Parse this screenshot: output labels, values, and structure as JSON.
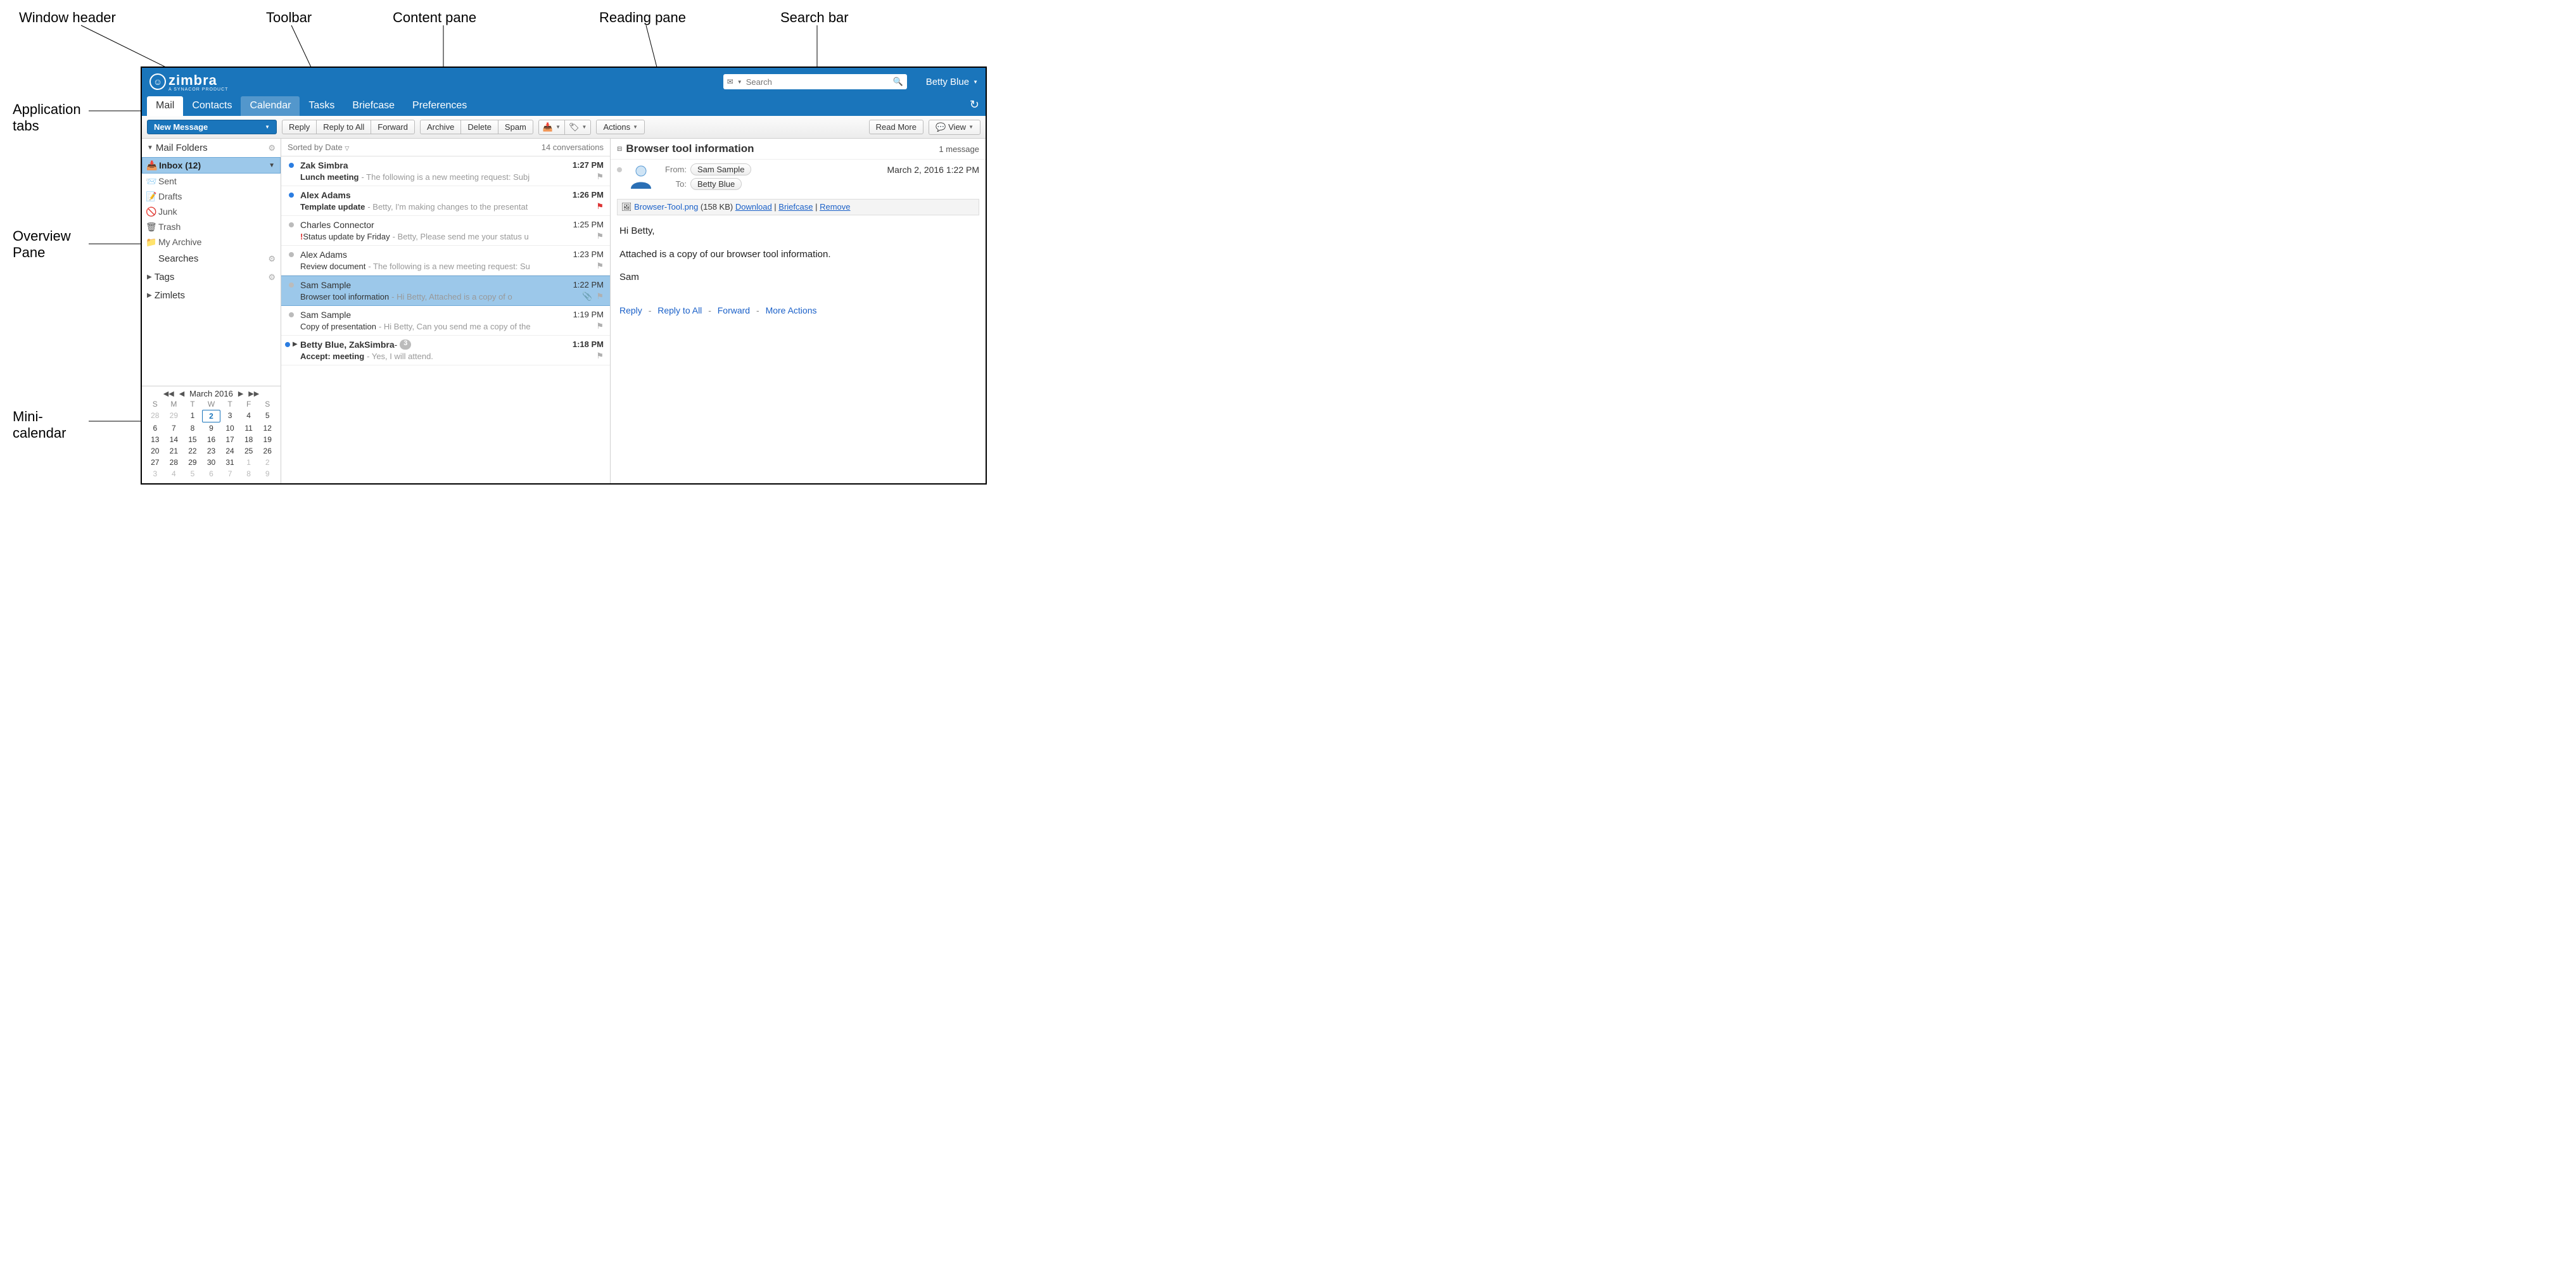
{
  "annotations": {
    "window_header": "Window header",
    "toolbar": "Toolbar",
    "content_pane": "Content pane",
    "reading_pane": "Reading pane",
    "search_bar": "Search bar",
    "app_tabs": "Application tabs",
    "overview_pane": "Overview Pane",
    "mini_calendar": "Mini-calendar"
  },
  "brand": {
    "name": "zimbra",
    "subtitle": "A SYNACOR PRODUCT"
  },
  "search": {
    "placeholder": "Search"
  },
  "user": {
    "name": "Betty Blue"
  },
  "tabs": [
    "Mail",
    "Contacts",
    "Calendar",
    "Tasks",
    "Briefcase",
    "Preferences"
  ],
  "active_tab": 0,
  "hover_tab": 2,
  "toolbar": {
    "new_message": "New Message",
    "reply": "Reply",
    "reply_all": "Reply to All",
    "forward": "Forward",
    "archive": "Archive",
    "delete": "Delete",
    "spam": "Spam",
    "actions": "Actions",
    "read_more": "Read More",
    "view": "View"
  },
  "sidebar": {
    "mail_folders": "Mail Folders",
    "folders": [
      {
        "name": "Inbox (12)",
        "icon": "inbox",
        "selected": true
      },
      {
        "name": "Sent",
        "icon": "sent"
      },
      {
        "name": "Drafts",
        "icon": "drafts"
      },
      {
        "name": "Junk",
        "icon": "junk"
      },
      {
        "name": "Trash",
        "icon": "trash"
      },
      {
        "name": "My Archive",
        "icon": "archive"
      }
    ],
    "searches": "Searches",
    "tags": "Tags",
    "zimlets": "Zimlets"
  },
  "minical": {
    "month": "March 2016",
    "dow": [
      "S",
      "M",
      "T",
      "W",
      "T",
      "F",
      "S"
    ],
    "weeks": [
      [
        {
          "d": 28,
          "om": true
        },
        {
          "d": 29,
          "om": true
        },
        {
          "d": 1
        },
        {
          "d": 2,
          "today": true
        },
        {
          "d": 3
        },
        {
          "d": 4
        },
        {
          "d": 5
        }
      ],
      [
        {
          "d": 6
        },
        {
          "d": 7
        },
        {
          "d": 8
        },
        {
          "d": 9
        },
        {
          "d": 10
        },
        {
          "d": 11
        },
        {
          "d": 12
        }
      ],
      [
        {
          "d": 13
        },
        {
          "d": 14
        },
        {
          "d": 15
        },
        {
          "d": 16
        },
        {
          "d": 17
        },
        {
          "d": 18
        },
        {
          "d": 19
        }
      ],
      [
        {
          "d": 20
        },
        {
          "d": 21
        },
        {
          "d": 22
        },
        {
          "d": 23
        },
        {
          "d": 24
        },
        {
          "d": 25
        },
        {
          "d": 26
        }
      ],
      [
        {
          "d": 27
        },
        {
          "d": 28
        },
        {
          "d": 29
        },
        {
          "d": 30
        },
        {
          "d": 31
        },
        {
          "d": 1,
          "om": true
        },
        {
          "d": 2,
          "om": true
        }
      ],
      [
        {
          "d": 3,
          "om": true
        },
        {
          "d": 4,
          "om": true
        },
        {
          "d": 5,
          "om": true
        },
        {
          "d": 6,
          "om": true
        },
        {
          "d": 7,
          "om": true
        },
        {
          "d": 8,
          "om": true
        },
        {
          "d": 9,
          "om": true
        }
      ]
    ]
  },
  "list": {
    "sort": "Sorted by Date",
    "count": "14 conversations",
    "items": [
      {
        "unread": true,
        "sender": "Zak Simbra",
        "time": "1:27 PM",
        "subject": "Lunch meeting",
        "snippet": "- The following is a new meeting request: Subj",
        "flag": "gray"
      },
      {
        "unread": true,
        "sender": "Alex Adams",
        "time": "1:26 PM",
        "subject": "Template update",
        "snippet": "- Betty, I'm making changes to the presentat",
        "flag": "red"
      },
      {
        "unread": false,
        "sender": "Charles Connector",
        "time": "1:25 PM",
        "subject": "Status update by Friday",
        "snippet": "- Betty, Please send me your status u",
        "flag": "gray",
        "priority": "high"
      },
      {
        "unread": false,
        "sender": "Alex Adams",
        "time": "1:23 PM",
        "subject": "Review document",
        "snippet": "- The following is a new meeting request: Su",
        "flag": "gray"
      },
      {
        "unread": false,
        "sender": "Sam Sample",
        "time": "1:22 PM",
        "subject": "Browser tool information",
        "snippet": "- Hi Betty, Attached is a copy of o",
        "flag": "gray",
        "attachment": true,
        "selected": true
      },
      {
        "unread": false,
        "sender": "Sam Sample",
        "time": "1:19 PM",
        "subject": "Copy of presentation",
        "snippet": "- Hi Betty, Can you send me a copy of the",
        "flag": "gray"
      },
      {
        "unread": true,
        "sender": "Betty Blue, ZakSimbra",
        "time": "1:18 PM",
        "subject": "Accept: meeting",
        "snippet": "- Yes, I will attend.",
        "flag": "gray",
        "expandable": true,
        "count": "3"
      }
    ]
  },
  "reading": {
    "title": "Browser tool information",
    "count": "1 message",
    "from_label": "From:",
    "to_label": "To:",
    "from": "Sam Sample",
    "to": "Betty Blue",
    "date": "March 2, 2016 1:22 PM",
    "attachment": {
      "name": "Browser-Tool.png",
      "size": "(158 KB)",
      "download": "Download",
      "briefcase": "Briefcase",
      "remove": "Remove"
    },
    "body_lines": [
      "Hi Betty,",
      "Attached is a copy of our browser tool information.",
      "Sam"
    ],
    "actions": {
      "reply": "Reply",
      "reply_all": "Reply to All",
      "forward": "Forward",
      "more": "More Actions"
    }
  }
}
